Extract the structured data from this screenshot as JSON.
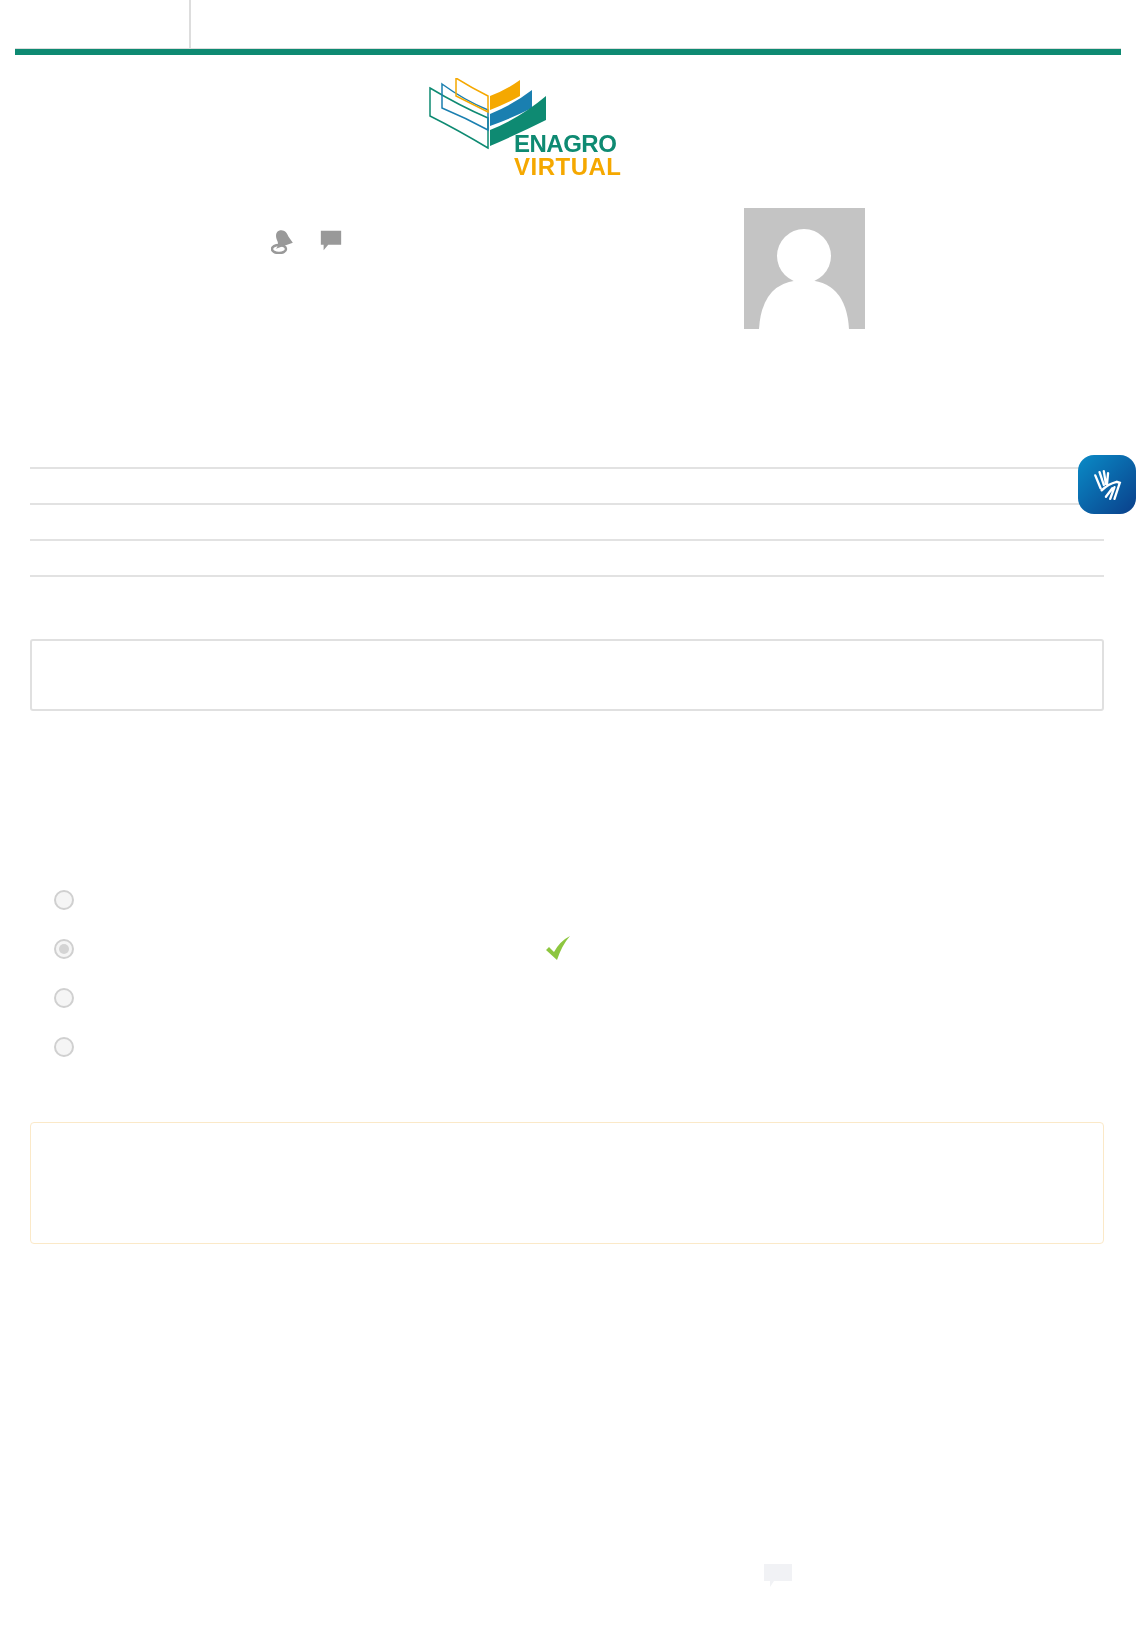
{
  "logo": {
    "line_1": "ENAGRO",
    "line_2": "VIRTUAL"
  },
  "options": [
    {
      "selected": false,
      "correct": false
    },
    {
      "selected": true,
      "correct": true
    },
    {
      "selected": false,
      "correct": false
    },
    {
      "selected": false,
      "correct": false
    }
  ]
}
